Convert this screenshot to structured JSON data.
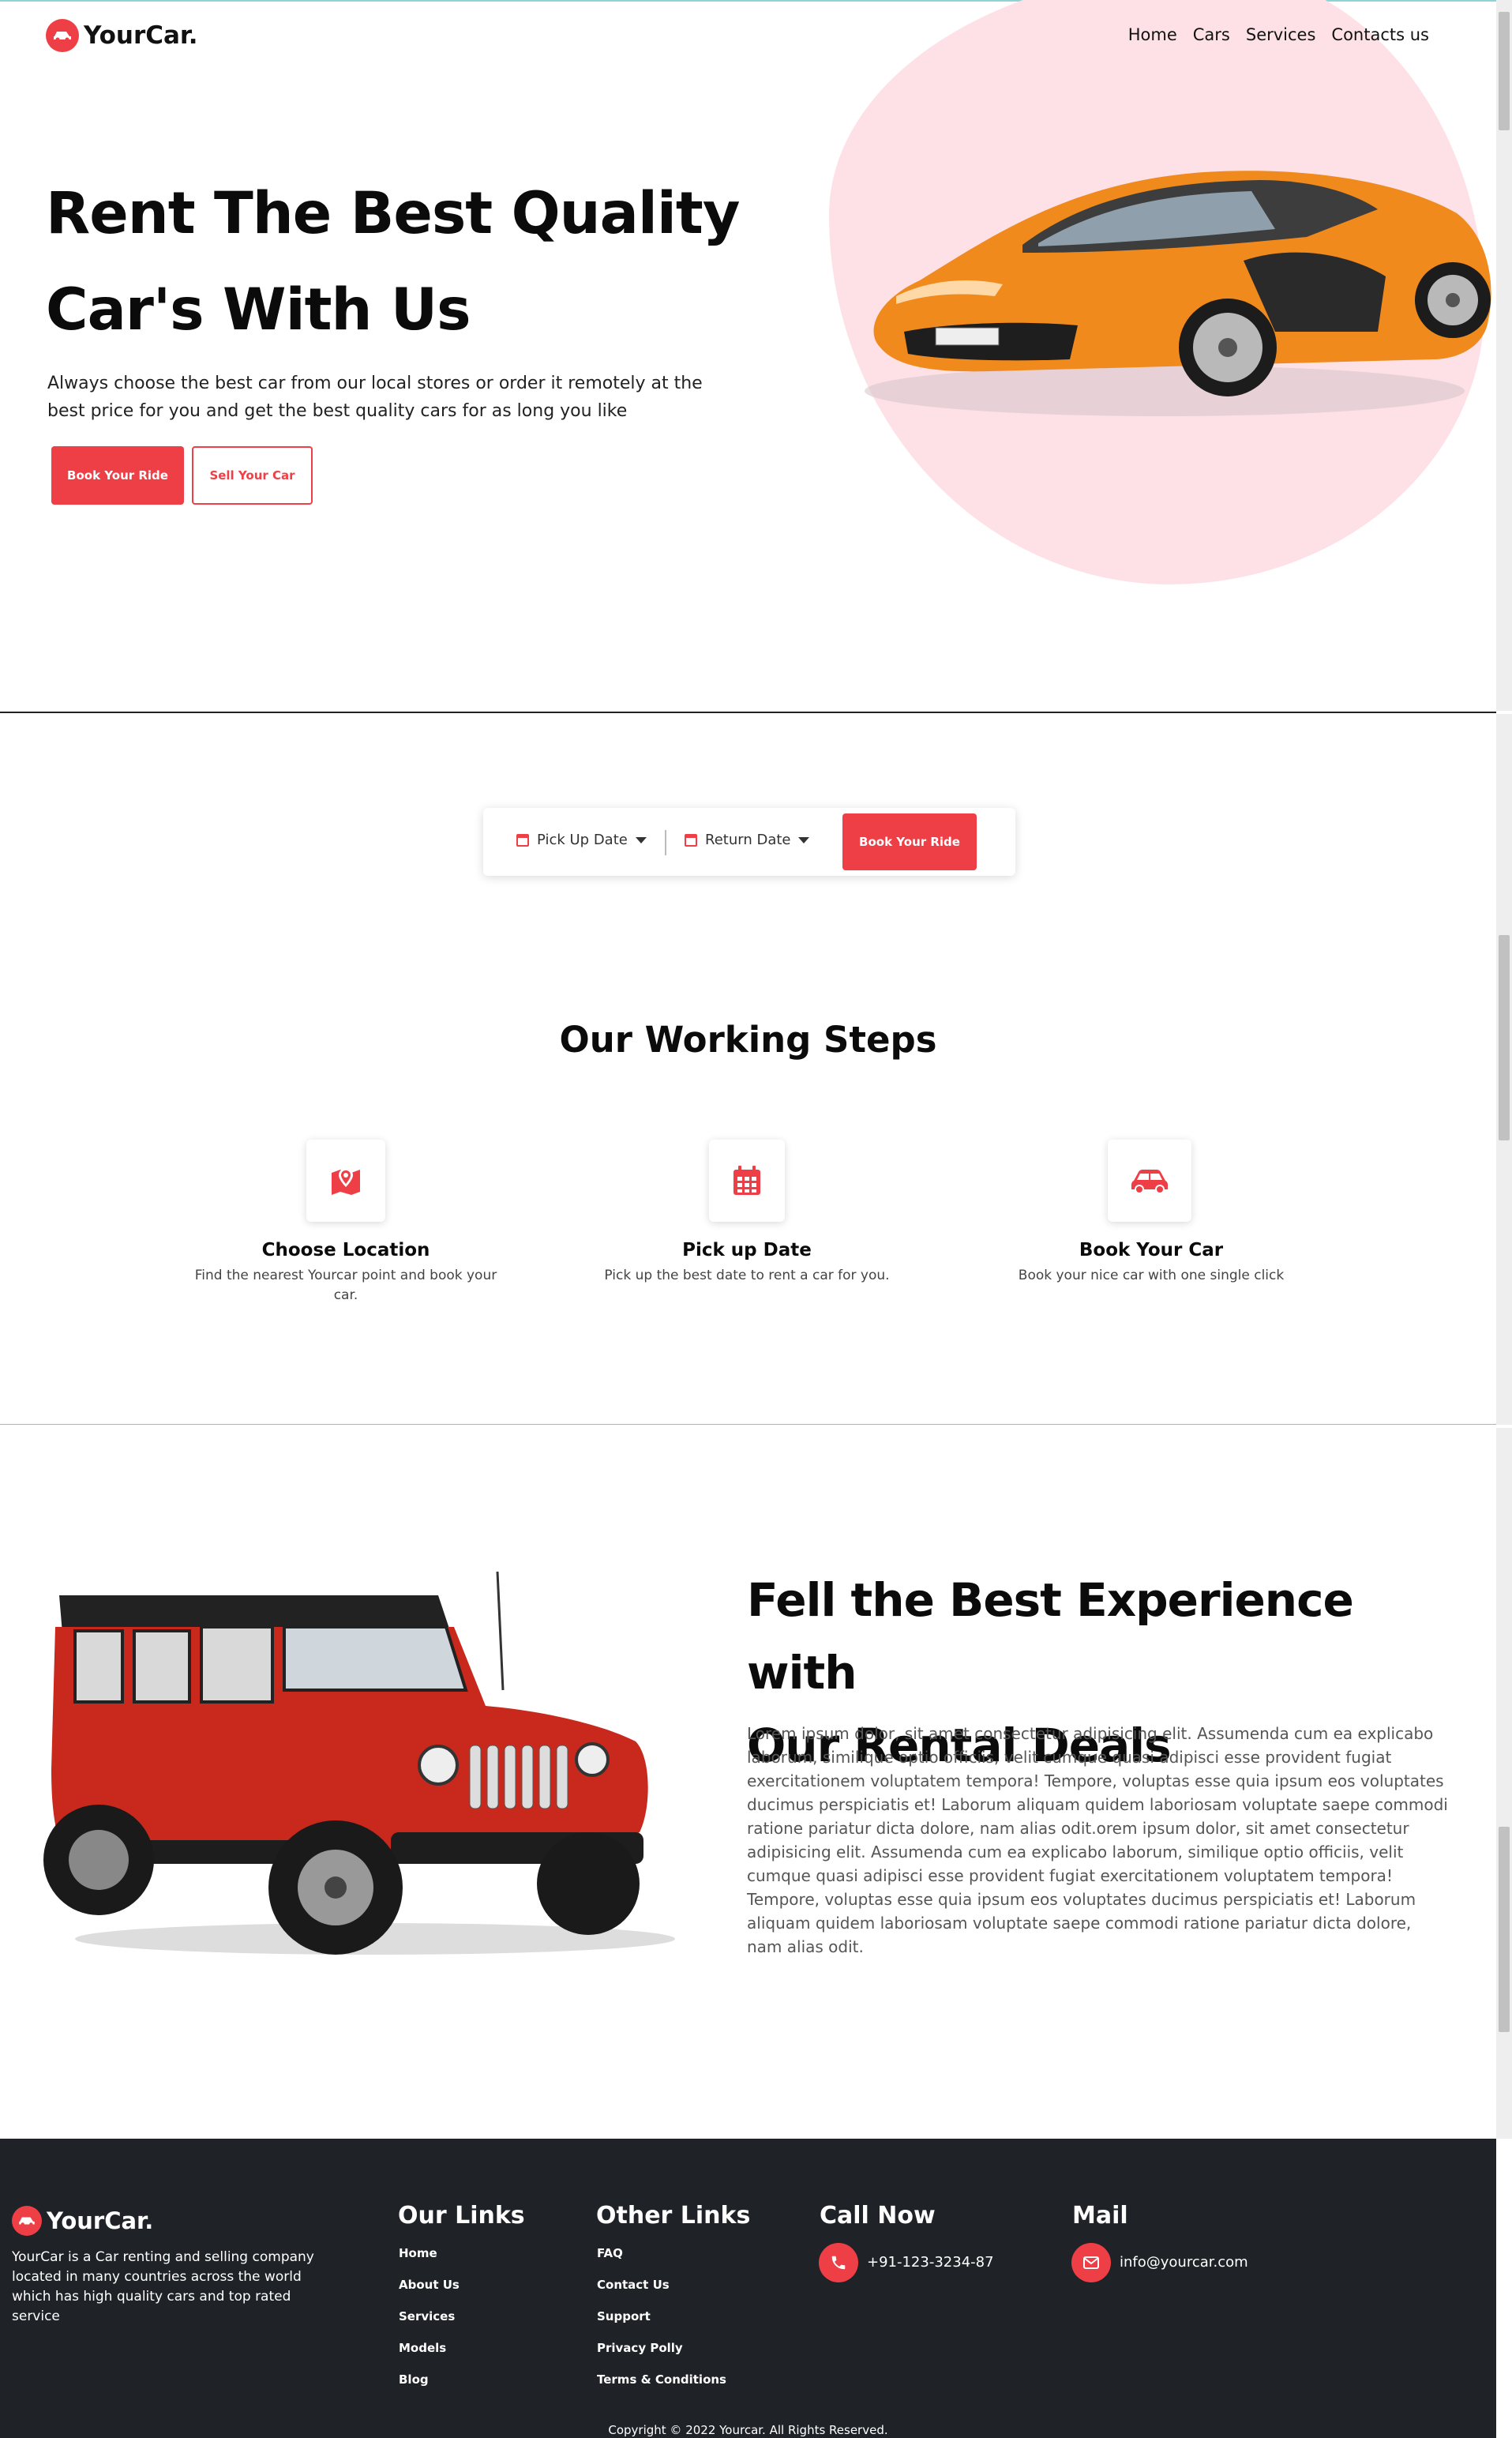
{
  "brand": {
    "name": "YourCar."
  },
  "nav": {
    "items": [
      "Home",
      "Cars",
      "Services",
      "Contacts us"
    ]
  },
  "hero": {
    "title_line1": "Rent The Best Quality",
    "title_line2": "Car's With Us",
    "description": "Always choose the best car from our local stores or order it remotely at the best price for you and get the best quality cars for as long you like",
    "primary_button": "Book Your Ride",
    "secondary_button": "Sell Your Car",
    "image_icon": "orange-sports-car-image"
  },
  "booking": {
    "pickup_label": "Pick Up Date",
    "return_label": "Return Date",
    "button": "Book Your Ride"
  },
  "steps": {
    "title": "Our Working Steps",
    "items": [
      {
        "icon": "map-location-icon",
        "title": "Choose Location",
        "description": "Find the nearest Yourcar point and book your car."
      },
      {
        "icon": "calendar-icon",
        "title": "Pick up Date",
        "description": "Pick up the best date to rent a car for you."
      },
      {
        "icon": "car-icon",
        "title": "Book Your Car",
        "description": "Book your nice car with one single click"
      }
    ]
  },
  "experience": {
    "title_line1": "Fell the Best Experience with",
    "title_line2": "Our Rental Deals",
    "paragraph": "Lorem ipsum dolor, sit amet consectetur adipisicing elit. Assumenda cum ea explicabo laborum, similique optio officiis, velit cumque quasi adipisci esse provident fugiat exercitationem voluptatem tempora! Tempore, voluptas esse quia ipsum eos voluptates ducimus perspiciatis et! Laborum aliquam quidem laboriosam voluptate saepe commodi ratione pariatur dicta dolore, nam alias odit.orem ipsum dolor, sit amet consectetur adipisicing elit. Assumenda cum ea explicabo laborum, similique optio officiis, velit cumque quasi adipisci esse provident fugiat exercitationem voluptatem tempora! Tempore, voluptas esse quia ipsum eos voluptates ducimus perspiciatis et! Laborum aliquam quidem laboriosam voluptate saepe commodi ratione pariatur dicta dolore, nam alias odit.",
    "image_icon": "red-jeep-image"
  },
  "footer": {
    "brand": "YourCar.",
    "about": "YourCar is a Car renting and selling company located in many countries across the world which has high quality cars and top rated service",
    "our_links_title": "Our Links",
    "our_links": [
      "Home",
      "About Us",
      "Services",
      "Models",
      "Blog"
    ],
    "other_links_title": "Other Links",
    "other_links": [
      "FAQ",
      "Contact Us",
      "Support",
      "Privacy Polly",
      "Terms & Conditions"
    ],
    "call_title": "Call Now",
    "phone": "+91-123-3234-87",
    "mail_title": "Mail",
    "email": "info@yourcar.com",
    "copyright": "Copyright © 2022 Yourcar. All Rights Reserved."
  },
  "colors": {
    "accent": "#ef3f46",
    "blob": "#fde1e6",
    "footer_bg": "#1f2226"
  }
}
